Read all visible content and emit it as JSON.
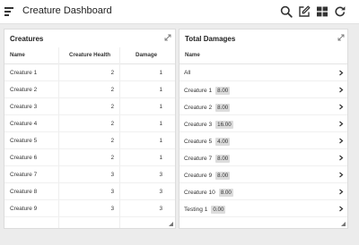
{
  "app": {
    "title": "Creature Dashboard"
  },
  "toolbar": {
    "icons": [
      "menu-icon",
      "search-icon",
      "edit-icon",
      "grid-icon",
      "refresh-icon"
    ]
  },
  "creatures_panel": {
    "title": "Creatures",
    "columns": [
      "Name",
      "Creature Health",
      "Damage"
    ],
    "rows": [
      {
        "name": "Creature 1",
        "health": "2",
        "damage": "1"
      },
      {
        "name": "Creature 2",
        "health": "2",
        "damage": "1"
      },
      {
        "name": "Creature 3",
        "health": "2",
        "damage": "1"
      },
      {
        "name": "Creature 4",
        "health": "2",
        "damage": "1"
      },
      {
        "name": "Creature 5",
        "health": "2",
        "damage": "1"
      },
      {
        "name": "Creature 6",
        "health": "2",
        "damage": "1"
      },
      {
        "name": "Creature 7",
        "health": "3",
        "damage": "3"
      },
      {
        "name": "Creature 8",
        "health": "3",
        "damage": "3"
      },
      {
        "name": "Creature 9",
        "health": "3",
        "damage": "3"
      }
    ]
  },
  "damages_panel": {
    "title": "Total Damages",
    "column": "Name",
    "items": [
      {
        "label": "All",
        "value": ""
      },
      {
        "label": "Creature 1",
        "value": "8.00"
      },
      {
        "label": "Creature 2",
        "value": "8.00"
      },
      {
        "label": "Creature 3",
        "value": "16.00"
      },
      {
        "label": "Creature 5",
        "value": "4.00"
      },
      {
        "label": "Creature 7",
        "value": "8.00"
      },
      {
        "label": "Creature 9",
        "value": "8.00"
      },
      {
        "label": "Creature 10",
        "value": "8.00"
      },
      {
        "label": "Testing 1",
        "value": "0.00"
      }
    ]
  }
}
